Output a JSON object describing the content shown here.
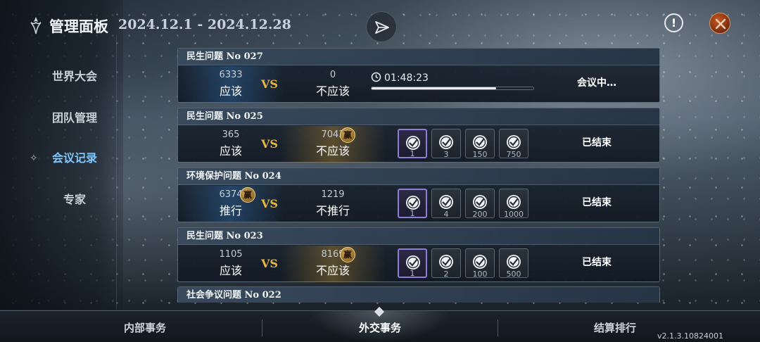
{
  "header": {
    "title": "管理面板",
    "date_range": "2024.12.1 - 2024.12.28",
    "info_label": "!"
  },
  "sidebar": {
    "items": [
      {
        "label": "世界大会",
        "active": false
      },
      {
        "label": "团队管理",
        "active": false
      },
      {
        "label": "会议记录",
        "active": true
      },
      {
        "label": "专家",
        "active": false
      }
    ]
  },
  "meetings": [
    {
      "title": "民生问题 No 027",
      "side_a": {
        "count": "6333",
        "label": "应该"
      },
      "vs": "VS",
      "side_b": {
        "count": "0",
        "label": "不应该"
      },
      "timer": "01:48:23",
      "progress": 0.77,
      "status": "会议中…"
    },
    {
      "title": "民生问题 No 025",
      "side_a": {
        "count": "365",
        "label": "应该"
      },
      "vs": "VS",
      "side_b": {
        "count": "7043",
        "label": "不应该"
      },
      "winner": "b",
      "win_label": "赢",
      "rewards": [
        "1",
        "3",
        "150",
        "750"
      ],
      "status": "已结束"
    },
    {
      "title": "环境保护问题 No 024",
      "side_a": {
        "count": "6374",
        "label": "推行"
      },
      "vs": "VS",
      "side_b": {
        "count": "1219",
        "label": "不推行"
      },
      "winner": "a",
      "win_label": "赢",
      "rewards": [
        "1",
        "4",
        "200",
        "1000"
      ],
      "status": "已结束"
    },
    {
      "title": "民生问题 No 023",
      "side_a": {
        "count": "1105",
        "label": "应该"
      },
      "vs": "VS",
      "side_b": {
        "count": "8169",
        "label": "不应该"
      },
      "winner": "b",
      "win_label": "赢",
      "rewards": [
        "1",
        "2",
        "100",
        "500"
      ],
      "status": "已结束"
    },
    {
      "title": "社会争议问题 No 022"
    }
  ],
  "bottom_tabs": [
    {
      "label": "内部事务",
      "active": false
    },
    {
      "label": "外交事务",
      "active": true
    },
    {
      "label": "结算排行",
      "active": false
    }
  ],
  "version": "v2.1.3.10824001",
  "colors": {
    "vs": "#e8b63e",
    "active_sidebar": "#7ec8ff",
    "win_badge": "#d7b05a"
  }
}
